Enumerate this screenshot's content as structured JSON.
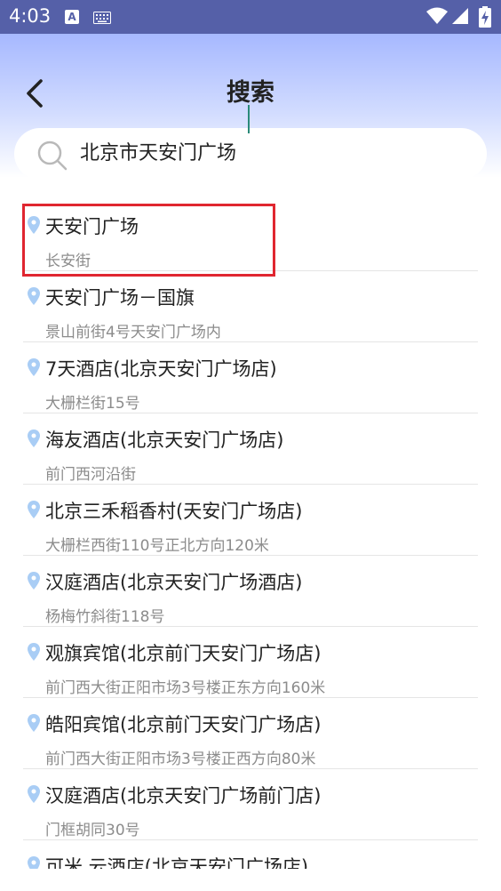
{
  "status_bar": {
    "time": "4:03",
    "notification_icon_letter": "A"
  },
  "header": {
    "title": "搜索"
  },
  "search": {
    "value": "北京市天安门广场"
  },
  "results": [
    {
      "name": "天安门广场",
      "address": "长安街"
    },
    {
      "name": "天安门广场－国旗",
      "address": "景山前街4号天安门广场内"
    },
    {
      "name": "7天酒店(北京天安门广场店)",
      "address": "大栅栏街15号"
    },
    {
      "name": "海友酒店(北京天安门广场店)",
      "address": "前门西河沿街"
    },
    {
      "name": "北京三禾稻香村(天安门广场店)",
      "address": "大栅栏西街110号正北方向120米"
    },
    {
      "name": "汉庭酒店(北京天安门广场酒店)",
      "address": "杨梅竹斜街118号"
    },
    {
      "name": "观旗宾馆(北京前门天安门广场店)",
      "address": "前门西大街正阳市场3号楼正东方向160米"
    },
    {
      "name": "皓阳宾馆(北京前门天安门广场店)",
      "address": "前门西大街正阳市场3号楼正西方向80米"
    },
    {
      "name": "汉庭酒店(北京天安门广场前门店)",
      "address": "门框胡同30号"
    },
    {
      "name": "可米 云酒店(北京天安门广场店)",
      "address": ""
    }
  ],
  "colors": {
    "status_bar": "#5560a8",
    "header_gradient_top": "#a6b8ff",
    "pin": "#a9cdf5",
    "highlight": "#e02630",
    "caret": "#2a8a7a"
  }
}
